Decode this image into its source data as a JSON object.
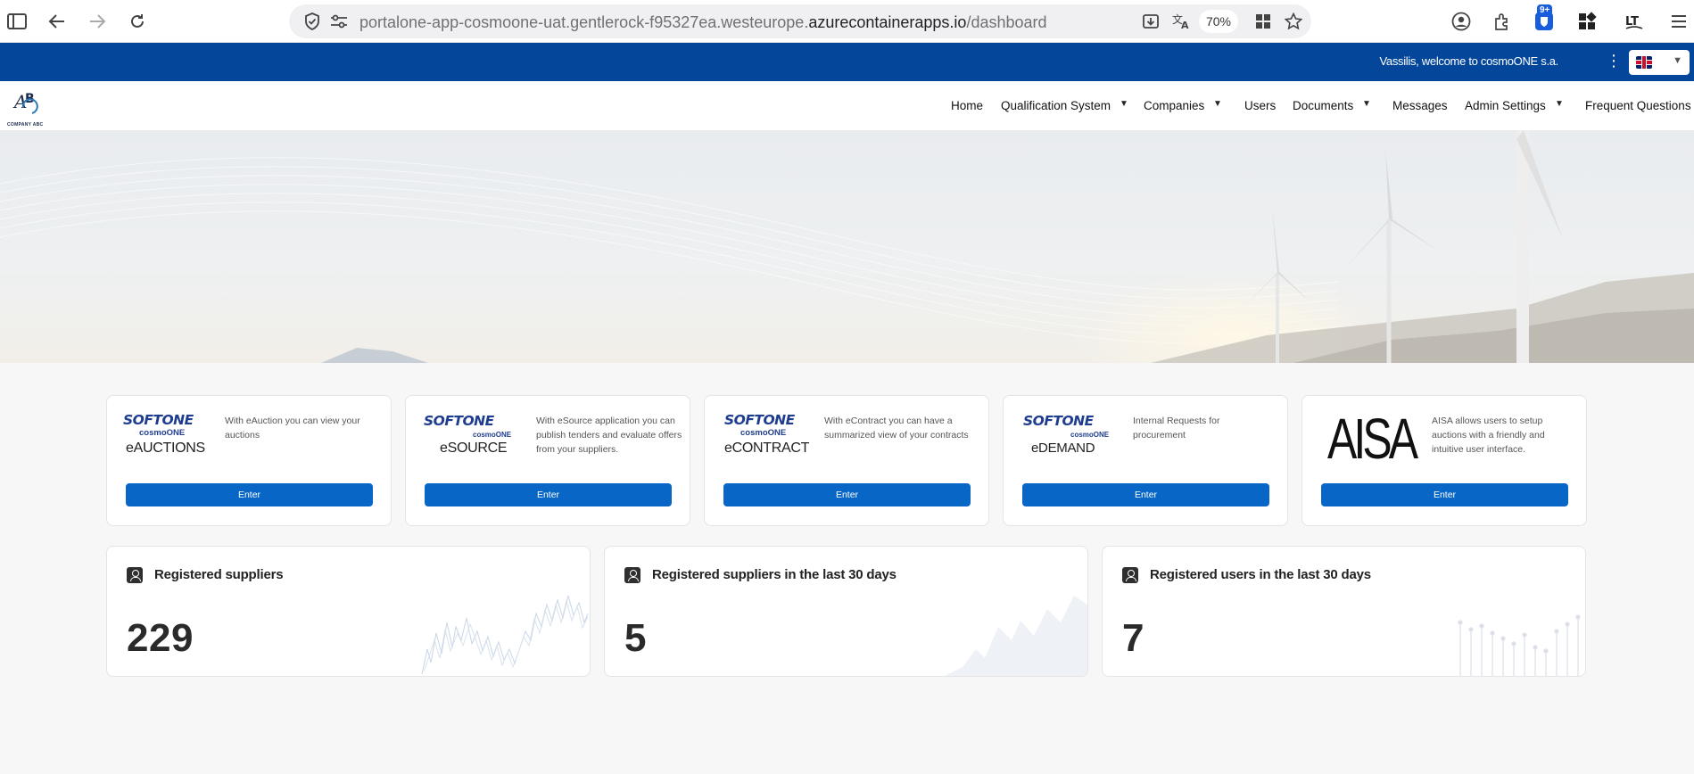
{
  "browser": {
    "url_prefix": "portalone-app-cosmoone-uat.gentlerock-f95327ea.westeurope.",
    "url_domain": "azurecontainerapps.io",
    "url_path": "/dashboard",
    "zoom": "70%",
    "badge": "9+"
  },
  "topbar": {
    "welcome": "Vassilis, welcome to cosmoONE s.a.",
    "menu_glyph": "⋮"
  },
  "logo": {
    "text": "COMPANY ABC"
  },
  "nav": {
    "items": [
      {
        "label": "Home"
      },
      {
        "label": "Qualification System"
      },
      {
        "label": "Companies"
      },
      {
        "label": "Users"
      },
      {
        "label": "Documents"
      },
      {
        "label": "Messages"
      },
      {
        "label": "Admin Settings"
      },
      {
        "label": "Frequent Questions"
      }
    ]
  },
  "apps": [
    {
      "brand": "SOFTONE",
      "sub": "cosmoONE",
      "product": "eAUCTIONS",
      "desc": "With eAuction you can view your auctions",
      "button": "Enter"
    },
    {
      "brand": "SOFTONE",
      "sub": "cosmoONE",
      "product": "eSOURCE",
      "desc": "With eSource application you can publish tenders and evaluate offers from your suppliers.",
      "button": "Enter"
    },
    {
      "brand": "SOFTONE",
      "sub": "cosmoONE",
      "product": "eCONTRACT",
      "desc": "With eContract you can have a summarized view of your contracts",
      "button": "Enter"
    },
    {
      "brand": "SOFTONE",
      "sub": "cosmoONE",
      "product": "eDEMAND",
      "desc": "Internal Requests for procurement",
      "button": "Enter"
    },
    {
      "brand": "AISA",
      "desc": "AISA allows users to setup auctions with a friendly and intuitive user interface.",
      "button": "Enter"
    }
  ],
  "stats": [
    {
      "title": "Registered suppliers",
      "value": "229"
    },
    {
      "title": "Registered suppliers in the last 30 days",
      "value": "5"
    },
    {
      "title": "Registered users in the last 30 days",
      "value": "7"
    }
  ],
  "colors": {
    "topbar": "#04479a",
    "button": "#0866c6",
    "brand": "#1f3d8f"
  }
}
